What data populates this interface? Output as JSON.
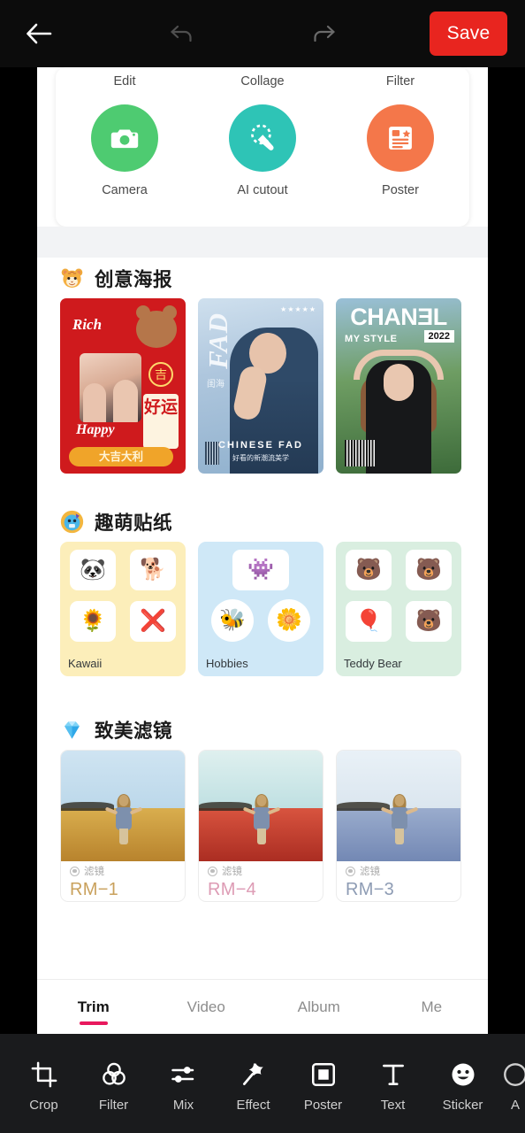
{
  "header": {
    "back_icon": "arrow-left-icon",
    "undo_icon": "undo-icon",
    "redo_icon": "redo-icon",
    "save_label": "Save",
    "save_color": "#e8251f"
  },
  "tool_card": {
    "top_labels": [
      "Edit",
      "Collage",
      "Filter"
    ],
    "items": [
      {
        "label": "Camera",
        "icon": "camera-icon",
        "color": "#4ecb71"
      },
      {
        "label": "AI cutout",
        "icon": "magic-wand-icon",
        "color": "#2ec4b6"
      },
      {
        "label": "Poster",
        "icon": "poster-icon",
        "color": "#f4774a"
      }
    ]
  },
  "sections": [
    {
      "title": "创意海报",
      "emoji": "tiger-face-emoji",
      "cards": [
        {
          "name": "rich-happy-cny-poster",
          "rich": "Rich",
          "happy": "Happy",
          "ji": "吉",
          "haoyun": "好运",
          "banner": "大吉大利"
        },
        {
          "name": "fad-magazine-poster",
          "brand": "FAD",
          "sub": "闺海",
          "stars": "★★★★★",
          "caption": "CHINESE FAD",
          "caption2": "好看的新潮流美学"
        },
        {
          "name": "chanel-style-poster",
          "brand": "CHANƎL",
          "style": "MY STYLE",
          "year": "2022"
        }
      ]
    },
    {
      "title": "趣萌贴纸",
      "emoji": "blue-character-emoji",
      "cards": [
        {
          "label": "Kawaii",
          "stickers": [
            "🐼",
            "🐕",
            "🌻",
            "❌"
          ]
        },
        {
          "label": "Hobbies",
          "stickers": [
            "👾",
            "🐝",
            "🌼"
          ]
        },
        {
          "label": "Teddy Bear",
          "stickers": [
            "🐻",
            "🐻",
            "🎈",
            "🐻"
          ]
        }
      ]
    },
    {
      "title": "致美滤镜",
      "emoji": "diamond-emoji",
      "cards": [
        {
          "sub": "滤镜",
          "name": "RM−1",
          "name_color": "#c9a15c",
          "sky": "#bcd8ea",
          "field": "#d9ae4e"
        },
        {
          "sub": "滤镜",
          "name": "RM−4",
          "name_color": "#dd9bb4",
          "sky": "#bfe0e2",
          "field": "#cf4536"
        },
        {
          "sub": "滤镜",
          "name": "RM−3",
          "name_color": "#8e9cb4",
          "sky": "#dbe6ef",
          "field": "#8e9fc4"
        }
      ]
    }
  ],
  "tabs": [
    {
      "label": "Trim",
      "active": true
    },
    {
      "label": "Video",
      "active": false
    },
    {
      "label": "Album",
      "active": false
    },
    {
      "label": "Me",
      "active": false
    }
  ],
  "tab_indicator_color": "#e8185d",
  "bottombar": [
    {
      "label": "Crop",
      "icon": "crop-icon"
    },
    {
      "label": "Filter",
      "icon": "filter-circles-icon"
    },
    {
      "label": "Mix",
      "icon": "sliders-icon"
    },
    {
      "label": "Effect",
      "icon": "magic-star-icon"
    },
    {
      "label": "Poster",
      "icon": "square-frame-icon"
    },
    {
      "label": "Text",
      "icon": "text-t-icon"
    },
    {
      "label": "Sticker",
      "icon": "smiley-icon"
    },
    {
      "label": "A",
      "icon": "adjust-icon"
    }
  ]
}
